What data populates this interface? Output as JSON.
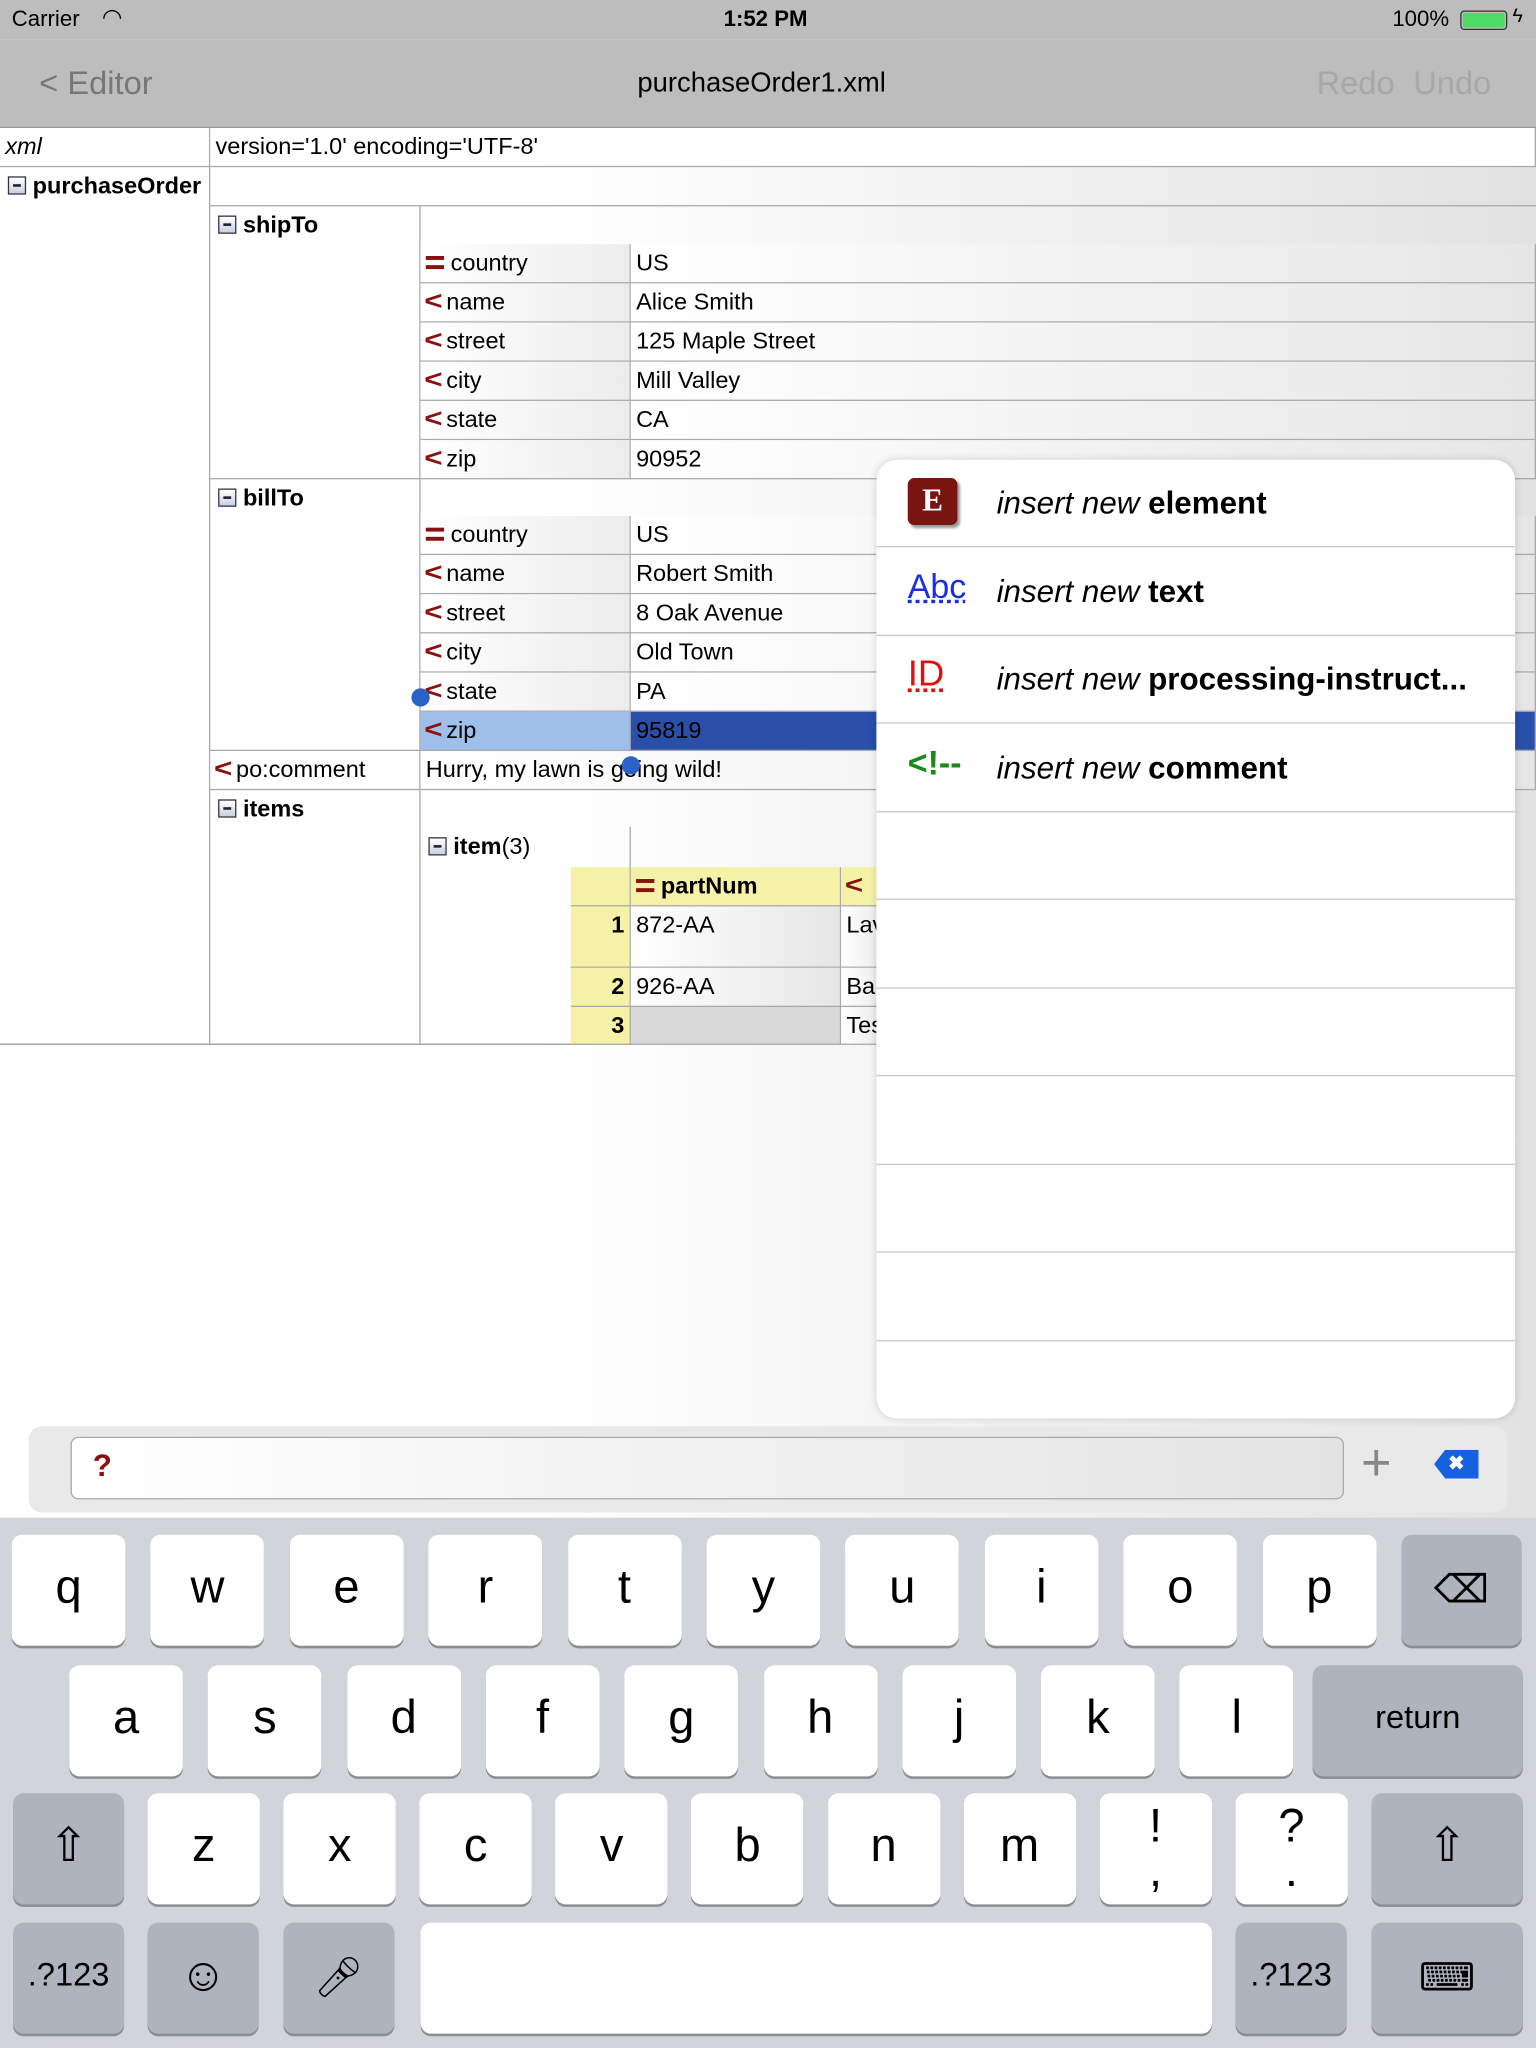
{
  "status_bar": {
    "carrier": "Carrier",
    "time": "1:52 PM",
    "battery": "100%"
  },
  "nav": {
    "back_label": "< Editor",
    "title": "purchaseOrder1.xml",
    "redo_label": "Redo",
    "undo_label": "Undo"
  },
  "xml_decl": {
    "name": "xml",
    "value": "version='1.0' encoding='UTF-8'"
  },
  "tree": {
    "root": "purchaseOrder",
    "shipTo": {
      "label": "shipTo",
      "rows": [
        {
          "type": "attribute",
          "name": "country",
          "value": "US"
        },
        {
          "type": "element",
          "name": "name",
          "value": "Alice Smith"
        },
        {
          "type": "element",
          "name": "street",
          "value": "125 Maple Street"
        },
        {
          "type": "element",
          "name": "city",
          "value": "Mill Valley"
        },
        {
          "type": "element",
          "name": "state",
          "value": "CA"
        },
        {
          "type": "element",
          "name": "zip",
          "value": "90952"
        }
      ]
    },
    "billTo": {
      "label": "billTo",
      "rows": [
        {
          "type": "attribute",
          "name": "country",
          "value": "US"
        },
        {
          "type": "element",
          "name": "name",
          "value": "Robert Smith"
        },
        {
          "type": "element",
          "name": "street",
          "value": "8 Oak Avenue"
        },
        {
          "type": "element",
          "name": "city",
          "value": "Old Town"
        },
        {
          "type": "element",
          "name": "state",
          "value": "PA"
        },
        {
          "type": "element",
          "name": "zip",
          "value": "95819",
          "selected": true
        }
      ]
    },
    "comment": {
      "name": "po:comment",
      "value": "Hurry, my lawn is going wild!"
    },
    "items": {
      "label": "items",
      "item_label": "item",
      "item_count": "(3)",
      "header": "partNum",
      "rows": [
        {
          "index": "1",
          "partNum": "872-AA",
          "next": "Lav"
        },
        {
          "index": "2",
          "partNum": "926-AA",
          "next": "Bal"
        },
        {
          "index": "3",
          "partNum": "",
          "next": "Tes"
        }
      ]
    }
  },
  "popover": {
    "items": [
      {
        "icon": "element-icon",
        "prefix": "insert new",
        "kind": "element"
      },
      {
        "icon": "text-icon",
        "prefix": "insert new",
        "kind": "text"
      },
      {
        "icon": "processing-instruction-icon",
        "prefix": "insert new",
        "kind": "processing-instruct..."
      },
      {
        "icon": "comment-icon",
        "prefix": "insert new",
        "kind": "comment"
      }
    ]
  },
  "keyboard": {
    "row1": [
      "q",
      "w",
      "e",
      "r",
      "t",
      "y",
      "u",
      "i",
      "o",
      "p"
    ],
    "row2": [
      "a",
      "s",
      "d",
      "f",
      "g",
      "h",
      "j",
      "k",
      "l"
    ],
    "row3": [
      "z",
      "x",
      "c",
      "v",
      "b",
      "n",
      "m",
      "!\n,",
      "?\n."
    ],
    "return_label": "return",
    "numbers_label": ".?123"
  },
  "colors": {
    "accent_blue": "#2a4fa8",
    "element_red": "#8b1010",
    "selection_light": "#9dbfe9"
  }
}
